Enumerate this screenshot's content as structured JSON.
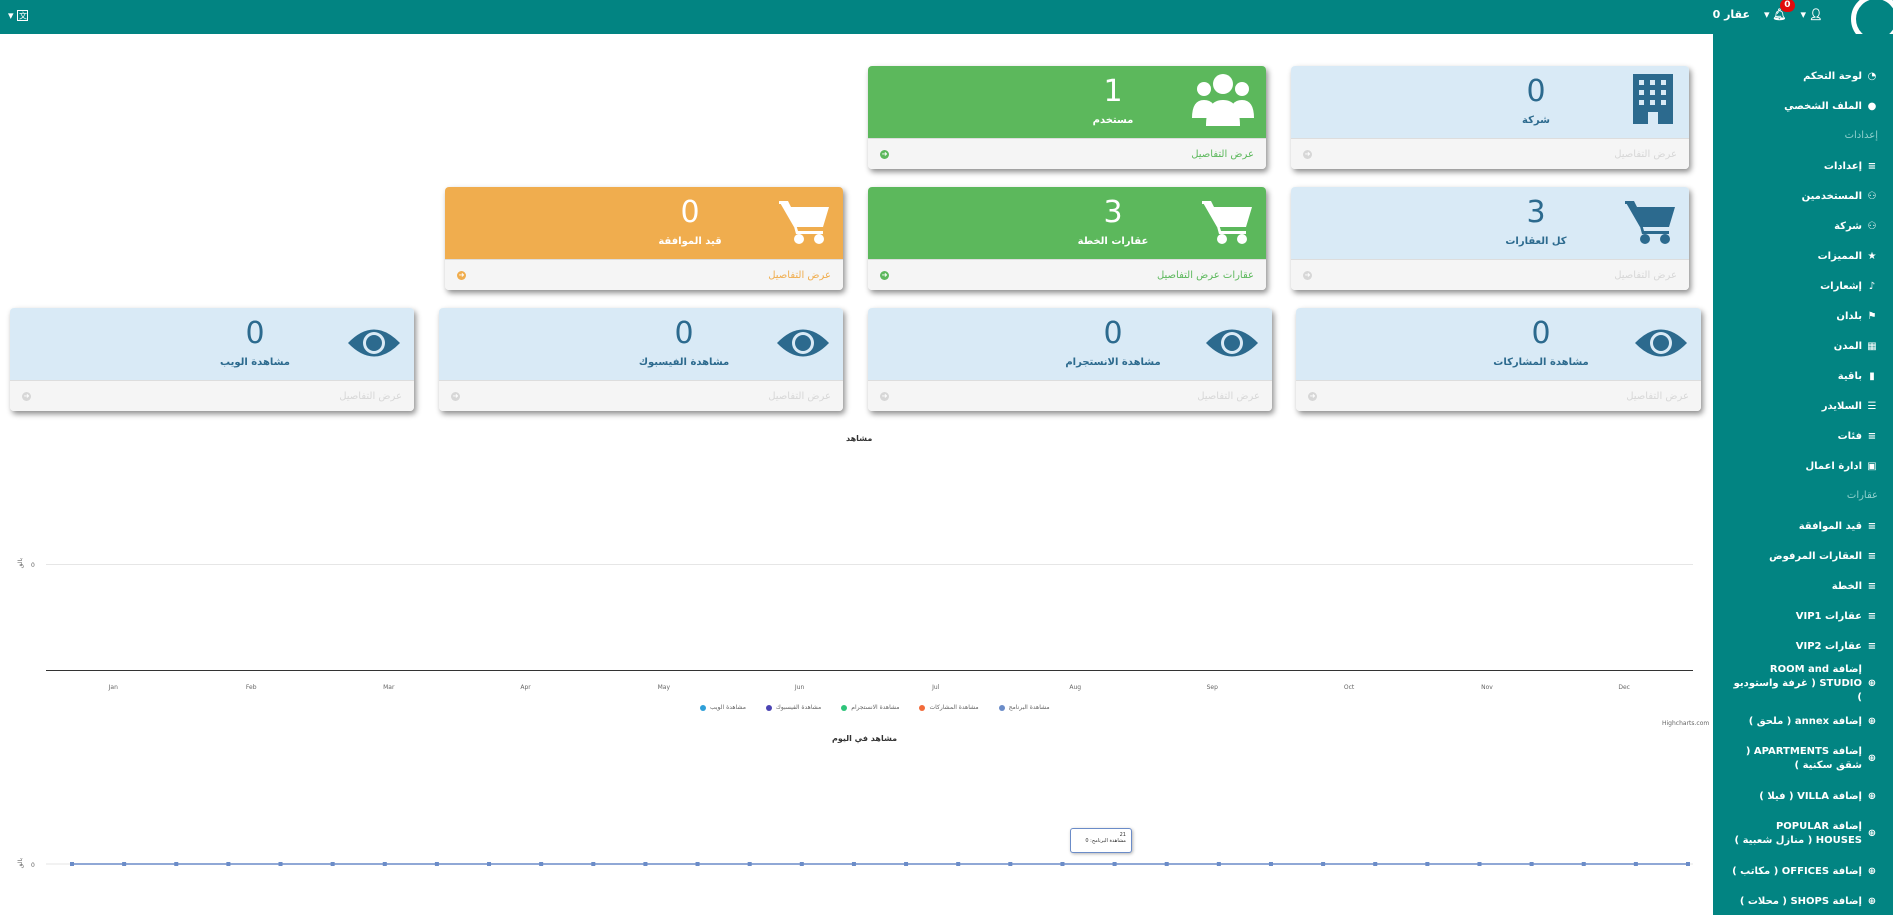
{
  "topbar": {
    "user_count_label": "0 عقار",
    "notifications_count": "0",
    "lang_icon": "translate-icon"
  },
  "sidebar": {
    "items": [
      {
        "label": "لوحة التحكم",
        "icon": "dashboard-icon",
        "type": "item"
      },
      {
        "label": "الملف الشخصي",
        "icon": "user-icon",
        "type": "item"
      },
      {
        "label": "إعدادات",
        "type": "header"
      },
      {
        "label": "إعدادات",
        "icon": "list-icon",
        "type": "item"
      },
      {
        "label": "المستخدمين",
        "icon": "users-icon",
        "type": "item"
      },
      {
        "label": "شركة",
        "icon": "users-icon",
        "type": "item"
      },
      {
        "label": "المميزات",
        "icon": "star-icon",
        "type": "item"
      },
      {
        "label": "إشعارات",
        "icon": "bell-icon",
        "type": "item"
      },
      {
        "label": "بلدان",
        "icon": "flag-icon",
        "type": "item"
      },
      {
        "label": "المدن",
        "icon": "building-icon",
        "type": "item"
      },
      {
        "label": "باقية",
        "icon": "book-icon",
        "type": "item"
      },
      {
        "label": "السلايدر",
        "icon": "sliders-icon",
        "type": "item"
      },
      {
        "label": "فئات",
        "icon": "list-icon",
        "type": "item"
      },
      {
        "label": "ادارة اعمال",
        "icon": "briefcase-icon",
        "type": "item"
      },
      {
        "label": "عقارات",
        "type": "header"
      },
      {
        "label": "قيد الموافقة",
        "icon": "list-icon",
        "type": "item"
      },
      {
        "label": "العقارات المرفوض",
        "icon": "list-icon",
        "type": "item"
      },
      {
        "label": "الخطة",
        "icon": "list-icon",
        "type": "item"
      },
      {
        "label": "عقارات VIP1",
        "icon": "list-icon",
        "type": "item"
      },
      {
        "label": "عقارات VIP2",
        "icon": "list-icon",
        "type": "item"
      },
      {
        "label": "إضافة ROOM and STUDIO ( غرفة واستوديو )",
        "icon": "plus-icon",
        "type": "tall"
      },
      {
        "label": "إضافة annex ( ملحق )",
        "icon": "plus-icon",
        "type": "item"
      },
      {
        "label": "إضافة APARTMENTS ( شقق سكنية )",
        "icon": "plus-icon",
        "type": "tall"
      },
      {
        "label": "إضافة VILLA ( فيلا )",
        "icon": "plus-icon",
        "type": "item"
      },
      {
        "label": "إضافة POPULAR HOUSES ( منازل شعبية )",
        "icon": "plus-icon",
        "type": "tall"
      },
      {
        "label": "إضافة OFFICES ( مكاتب )",
        "icon": "plus-icon",
        "type": "item"
      },
      {
        "label": "إضافة SHOPS ( محلات )",
        "icon": "plus-icon",
        "type": "item"
      }
    ]
  },
  "cards": {
    "company": {
      "value": "0",
      "label": "شركة",
      "link": "عرض التفاصيل",
      "icon": "building-icon"
    },
    "users": {
      "value": "1",
      "label": "مستخدم",
      "link": "عرض التفاصيل",
      "icon": "users-icon"
    },
    "all_properties": {
      "value": "3",
      "label": "كل العقارات",
      "link": "عرض التفاصيل",
      "icon": "cart-icon"
    },
    "plan_properties": {
      "value": "3",
      "label": "عقارات الخطة",
      "link": "عقارات عرض التفاصيل",
      "icon": "cart-icon"
    },
    "pending": {
      "value": "0",
      "label": "قيد الموافقة",
      "link": "عرض التفاصيل",
      "icon": "cart-icon"
    },
    "share_views": {
      "value": "0",
      "label": "مشاهدة المشاركات",
      "link": "عرض التفاصيل",
      "icon": "eye-icon"
    },
    "instagram_views": {
      "value": "0",
      "label": "مشاهدة الانستجرام",
      "link": "عرض التفاصيل",
      "icon": "eye-icon"
    },
    "facebook_views": {
      "value": "0",
      "label": "مشاهدة الفيسبوك",
      "link": "عرض التفاصيل",
      "icon": "eye-icon"
    },
    "web_views": {
      "value": "0",
      "label": "مشاهدة الويب",
      "link": "عرض التفاصيل",
      "icon": "eye-icon"
    }
  },
  "colors": {
    "teal": "#028482",
    "green": "#5cb85c",
    "orange": "#f0ad4e",
    "lightblue": "#d9eaf6",
    "darkblue": "#2c6a8e"
  },
  "chart_credit": "Highcharts.com",
  "chart_data": [
    {
      "type": "line",
      "title": "مشاهد",
      "categories": [
        "Jan",
        "Feb",
        "Mar",
        "Apr",
        "May",
        "Jun",
        "Jul",
        "Aug",
        "Sep",
        "Oct",
        "Nov",
        "Dec"
      ],
      "ylabel": "بالق",
      "yticks": [
        "0"
      ],
      "series": [
        {
          "name": "مشاهدة الويب",
          "color": "#2f9fd8",
          "values": [
            0,
            0,
            0,
            0,
            0,
            0,
            0,
            0,
            0,
            0,
            0,
            0
          ]
        },
        {
          "name": "مشاهدة الفيسبوك",
          "color": "#4b44b3",
          "values": [
            0,
            0,
            0,
            0,
            0,
            0,
            0,
            0,
            0,
            0,
            0,
            0
          ]
        },
        {
          "name": "مشاهدة الانستجرام",
          "color": "#2ec47a",
          "values": [
            0,
            0,
            0,
            0,
            0,
            0,
            0,
            0,
            0,
            0,
            0,
            0
          ]
        },
        {
          "name": "مشاهدة المشاركات",
          "color": "#f26b3a",
          "values": [
            0,
            0,
            0,
            0,
            0,
            0,
            0,
            0,
            0,
            0,
            0,
            0
          ]
        },
        {
          "name": "مشاهدة البرنامج",
          "color": "#6b8cc8",
          "values": [
            0,
            0,
            0,
            0,
            0,
            0,
            0,
            0,
            0,
            0,
            0,
            0
          ]
        }
      ]
    },
    {
      "type": "line",
      "title": "مشاهد في اليوم",
      "ylabel": "بالق",
      "yticks": [
        "0"
      ],
      "points": 32,
      "series": [
        {
          "name": "مشاهدة البرنامج",
          "color": "#6b8cc8",
          "values": [
            0,
            0,
            0,
            0,
            0,
            0,
            0,
            0,
            0,
            0,
            0,
            0,
            0,
            0,
            0,
            0,
            0,
            0,
            0,
            0,
            0,
            0,
            0,
            0,
            0,
            0,
            0,
            0,
            0,
            0,
            0,
            0
          ]
        }
      ],
      "tooltip": {
        "title": "21",
        "line": "مشاهدة البرنامج: 0"
      }
    }
  ]
}
